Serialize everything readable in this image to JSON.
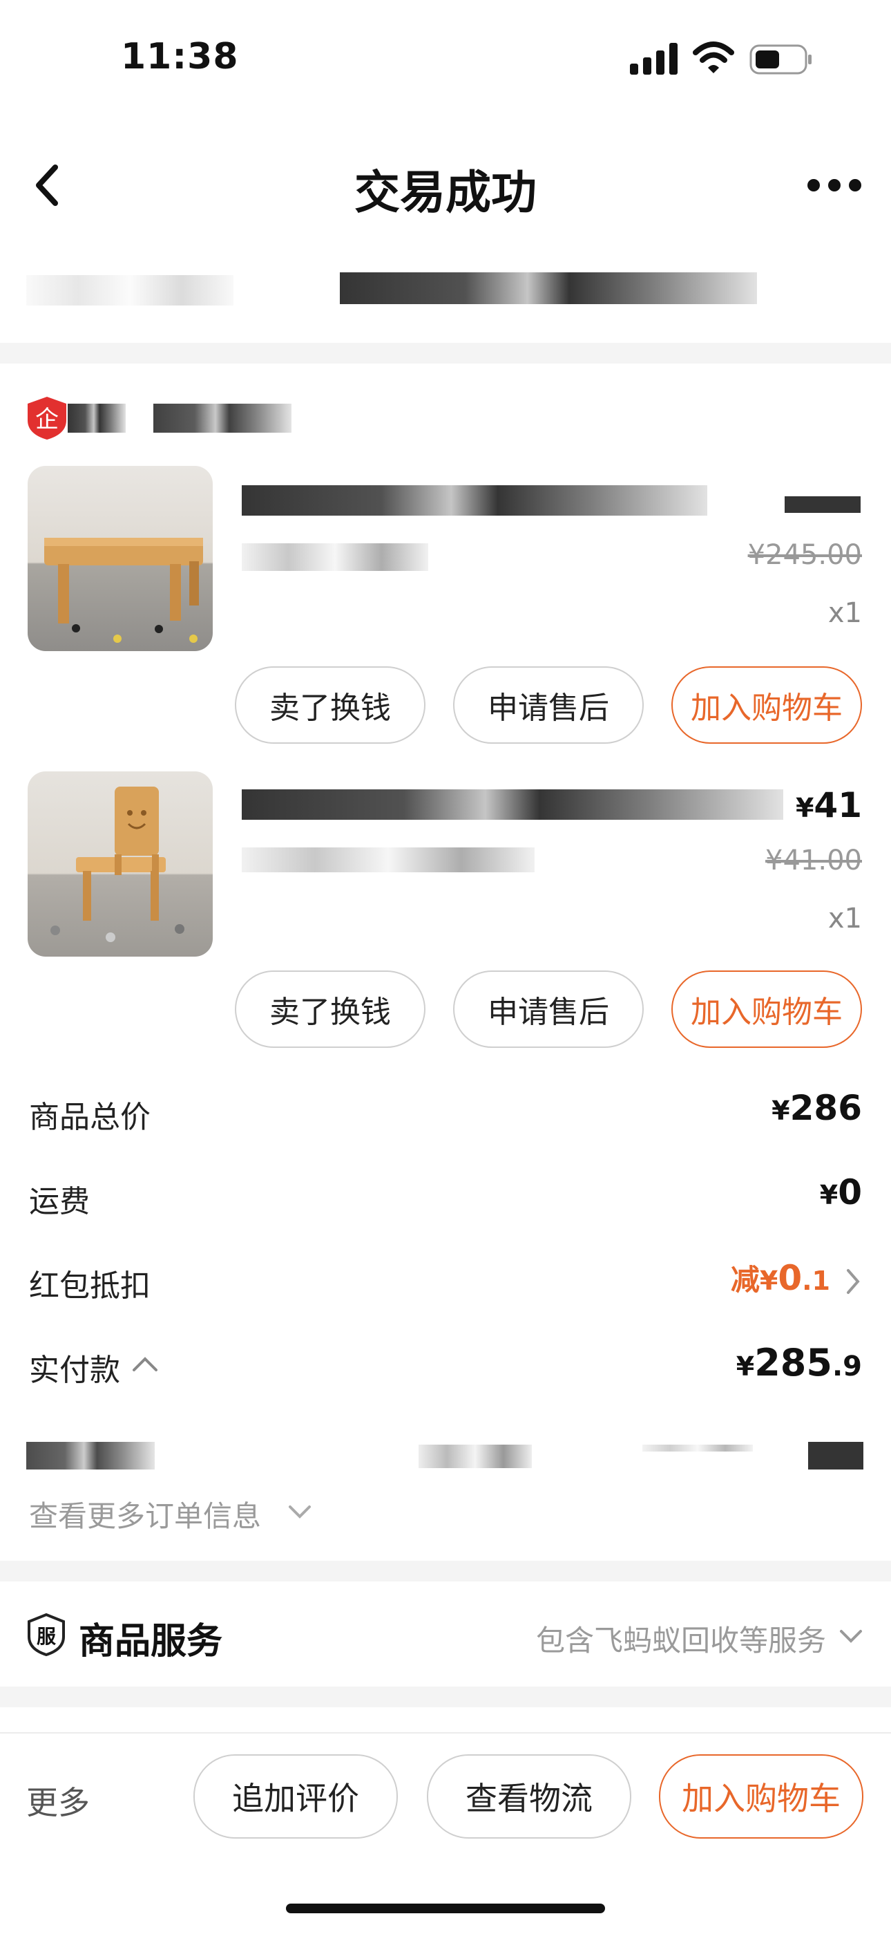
{
  "status_bar": {
    "time": "11:38"
  },
  "nav": {
    "title": "交易成功"
  },
  "items": [
    {
      "original_price": "¥245.00",
      "qty": "x1",
      "buttons": [
        "卖了换钱",
        "申请售后",
        "加入购物车"
      ]
    },
    {
      "price_symbol": "¥",
      "price": "41",
      "original_price": "¥41.00",
      "qty": "x1",
      "buttons": [
        "卖了换钱",
        "申请售后",
        "加入购物车"
      ]
    }
  ],
  "summary": {
    "total_label": "商品总价",
    "total_symbol": "¥",
    "total_value": "286",
    "shipping_label": "运费",
    "shipping_symbol": "¥",
    "shipping_value": "0",
    "discount_label": "红包抵扣",
    "discount_prefix": "减",
    "discount_symbol": "¥",
    "discount_value": "0",
    "discount_decimal": ".1",
    "paid_label": "实付款",
    "paid_symbol": "¥",
    "paid_value": "285",
    "paid_decimal": ".9",
    "more_info": "查看更多订单信息"
  },
  "service": {
    "icon_text": "服",
    "title": "商品服务",
    "desc": "包含飞蚂蚁回收等服务"
  },
  "bottom_bar": {
    "more": "更多",
    "buttons": [
      "追加评价",
      "查看物流",
      "加入购物车"
    ]
  },
  "colors": {
    "accent": "#e8672a",
    "badge_red": "#e2302f"
  }
}
